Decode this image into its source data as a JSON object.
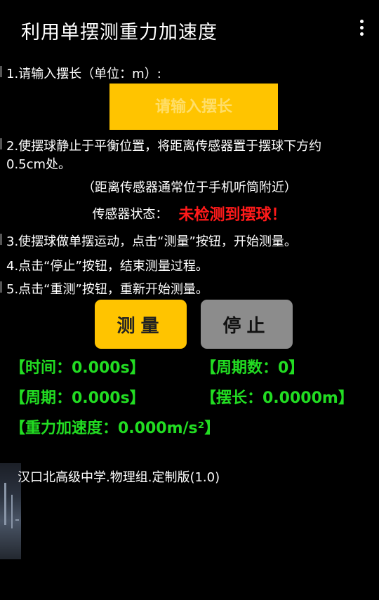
{
  "app_bar": {
    "title": "利用单摆测重力加速度",
    "menu_icon": "overflow-menu-icon"
  },
  "steps": {
    "step1": "1.请输入摆长（单位：m）:",
    "step2_line1": "2.使摆球静止于平衡位置，将距离传感器置于摆球下方约",
    "step2_line2": "0.5cm处。",
    "note": "（距离传感器通常位于手机听筒附近）",
    "step3": "3.使摆球做单摆运动，点击“测量”按钮，开始测量。",
    "step4": "4.点击“停止”按钮，结束测量过程。",
    "step5": "5.点击“重测”按钮，重新开始测量。"
  },
  "length_input": {
    "placeholder": "请输入摆长",
    "value": ""
  },
  "sensor": {
    "label": "传感器状态：",
    "status": "未检测到摆球！",
    "status_color": "#ff1a1a"
  },
  "buttons": {
    "measure": "测量",
    "stop": "停止"
  },
  "readouts": {
    "time": "【时间：0.000s】",
    "period_count": "【周期数：0】",
    "period": "【周期：0.000s】",
    "length": "【摆长：0.0000m】",
    "gravity": "【重力加速度：0.000m/s²】"
  },
  "footer": {
    "credit": "汉口北高级中学.物理组.定制版(1.0)"
  },
  "colors": {
    "accent": "#ffc400",
    "readout": "#22dd22",
    "stop_button": "#8c8c8c",
    "background": "#000000"
  }
}
